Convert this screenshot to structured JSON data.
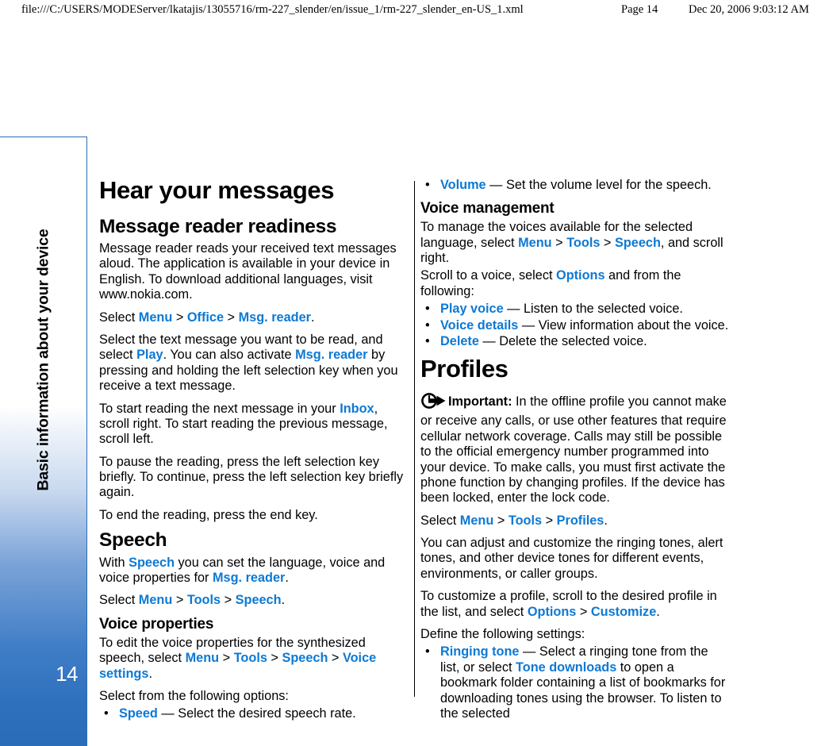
{
  "print_header": {
    "url": "file:///C:/USERS/MODEServer/lkatajis/13055716/rm-227_slender/en/issue_1/rm-227_slender_en-US_1.xml",
    "page": "Page 14",
    "date": "Dec 20, 2006 9:03:12 AM"
  },
  "sidebar": {
    "chapter_title": "Basic information about your device",
    "page_number": "14",
    "accent_color": "#2a6cb8"
  },
  "colors": {
    "link": "#0d79d4",
    "text": "#000000",
    "divider": "#000000"
  },
  "left_column": {
    "heading": "Hear your messages",
    "section_heading": "Message reader readiness",
    "p1": "Message reader reads your received text messages aloud. The application is available in your device in English. To download additional languages, visit www.nokia.com.",
    "select_path_1": {
      "lead": "Select ",
      "item1": "Menu",
      "sep1": " > ",
      "item2": "Office",
      "sep2": " > ",
      "item3": "Msg. reader",
      "tail": "."
    },
    "p2_a": "Select the text message you want to be read, and select ",
    "p2_link1": "Play",
    "p2_b": ". You can also activate ",
    "p2_link2": "Msg. reader",
    "p2_c": " by pressing and holding the left selection key when you receive a text message.",
    "p3_a": "To start reading the next message in your ",
    "p3_link": "Inbox",
    "p3_b": ", scroll right. To start reading the previous message, scroll left.",
    "p4": "To pause the reading, press the left selection key briefly. To continue, press the left selection key briefly again.",
    "p5": "To end the reading, press the end key.",
    "speech_heading": "Speech",
    "speech_p_a": "With ",
    "speech_p_link1": "Speech",
    "speech_p_b": " you can set the language, voice and voice properties for ",
    "speech_p_link2": "Msg. reader",
    "speech_p_c": ".",
    "select_path_2": {
      "lead": "Select ",
      "item1": "Menu",
      "sep1": " > ",
      "item2": "Tools",
      "sep2": " > ",
      "item3": "Speech",
      "tail": "."
    },
    "voice_props_heading": "Voice properties",
    "voice_props_p_a": "To edit the voice properties for the synthesized speech, select ",
    "voice_props_item1": "Menu",
    "voice_props_sep1": " > ",
    "voice_props_item2": "Tools",
    "voice_props_sep2": " > ",
    "voice_props_item3": "Speech",
    "voice_props_sep3": " > ",
    "voice_props_item4": "Voice settings",
    "voice_props_tail": ".",
    "options_lead": "Select from the following options:",
    "bullets": [
      {
        "bullet": "•",
        "term": "Speed",
        "dash": " — ",
        "desc": "Select the desired speech rate."
      }
    ]
  },
  "right_column": {
    "bullets_top": [
      {
        "bullet": "•",
        "term": "Volume",
        "dash": " — ",
        "desc": "Set the volume level for the speech."
      }
    ],
    "voice_mgmt_heading": "Voice management",
    "voice_mgmt_p_a": "To manage the voices available for the selected language, select ",
    "voice_mgmt_item1": "Menu",
    "voice_mgmt_sep1": " > ",
    "voice_mgmt_item2": "Tools",
    "voice_mgmt_sep2": " > ",
    "voice_mgmt_item3": "Speech",
    "voice_mgmt_tail": ", and scroll right.",
    "scroll_p_a": "Scroll to a voice, select ",
    "scroll_link": "Options",
    "scroll_p_b": " and from the following:",
    "bullets_voice": [
      {
        "bullet": "•",
        "term": "Play voice",
        "dash": " — ",
        "desc": "Listen to the selected voice."
      },
      {
        "bullet": "•",
        "term": "Voice details",
        "dash": " — ",
        "desc": "View information about the voice."
      },
      {
        "bullet": "•",
        "term": "Delete",
        "dash": " — ",
        "desc": "Delete the selected voice."
      }
    ],
    "profiles_heading": "Profiles",
    "note_icon_name": "important-note-icon",
    "note_label": "Important:",
    "note_text": " In the offline profile you cannot make or receive any calls, or use other features that require cellular network coverage. Calls may still be possible to the official emergency number programmed into your device. To make calls, you must first activate the phone function by changing profiles. If the device has been locked, enter the lock code.",
    "select_path_3": {
      "lead": "Select ",
      "item1": "Menu",
      "sep1": " > ",
      "item2": "Tools",
      "sep2": " > ",
      "item3": "Profiles",
      "tail": "."
    },
    "p_adjust": "You can adjust and customize the ringing tones, alert tones, and other device tones for different events, environments, or caller groups.",
    "p_customize_a": "To customize a profile, scroll to the desired profile in the list, and select ",
    "p_customize_link1": "Options",
    "p_customize_sep": " > ",
    "p_customize_link2": "Customize",
    "p_customize_tail": ".",
    "define_lead": "Define the following settings:",
    "bullets_settings": [
      {
        "bullet": "•",
        "term": "Ringing tone",
        "dash": " —  ",
        "desc_a": "Select a ringing tone from the list, or select ",
        "link": "Tone downloads",
        "desc_b": " to open a bookmark folder containing a list of bookmarks for downloading tones using the browser. To listen to the selected"
      }
    ]
  }
}
